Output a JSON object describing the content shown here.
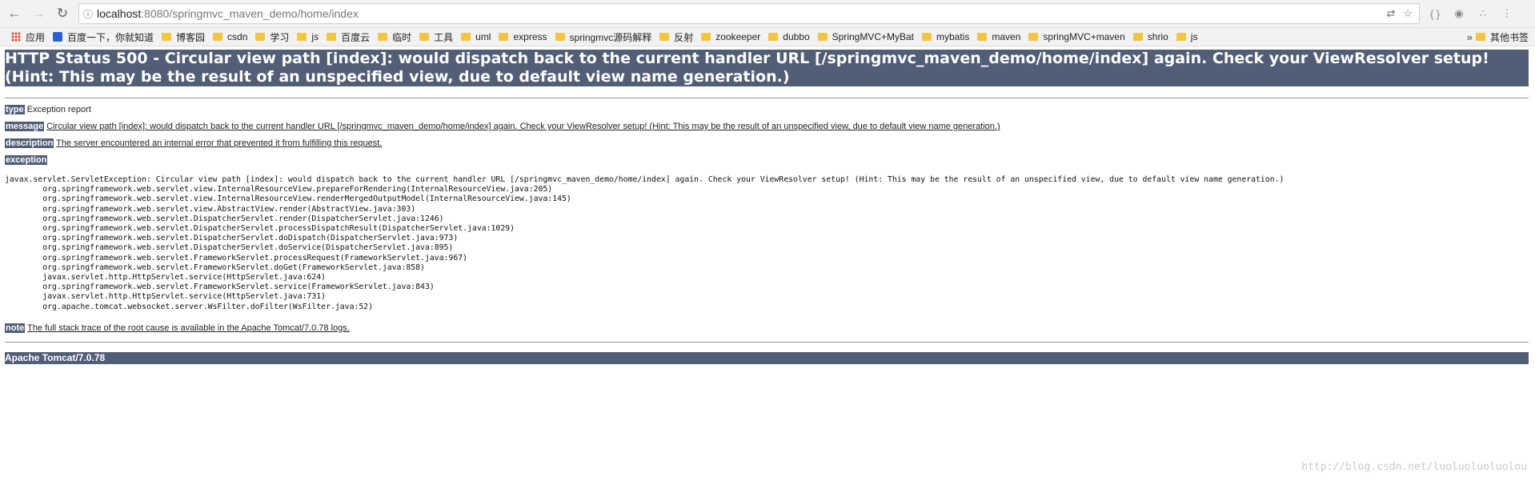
{
  "browser": {
    "url_host": "localhost",
    "url_path": ":8080/springmvc_maven_demo/home/index",
    "bookmarks": [
      "应用",
      "百度一下，你就知道",
      "博客园",
      "csdn",
      "学习",
      "js",
      "百度云",
      "临时",
      "工具",
      "uml",
      "express",
      "springmvc源码解释",
      "反射",
      "zookeeper",
      "dubbo",
      "SpringMVC+MyBat",
      "mybatis",
      "maven",
      "springMVC+maven",
      "shrio",
      "js"
    ],
    "more": "»",
    "other_bookmarks": "其他书签"
  },
  "error": {
    "title": "HTTP Status 500 - Circular view path [index]: would dispatch back to the current handler URL [/springmvc_maven_demo/home/index] again. Check your ViewResolver setup! (Hint: This may be the result of an unspecified view, due to default view name generation.)",
    "type_label": "type",
    "type_value": "Exception report",
    "message_label": "message",
    "message_value": "Circular view path [index]: would dispatch back to the current handler URL [/springmvc_maven_demo/home/index] again. Check your ViewResolver setup! (Hint: This may be the result of an unspecified view, due to default view name generation.)",
    "description_label": "description",
    "description_value": "The server encountered an internal error that prevented it from fulfilling this request.",
    "exception_label": "exception",
    "trace": "javax.servlet.ServletException: Circular view path [index]: would dispatch back to the current handler URL [/springmvc_maven_demo/home/index] again. Check your ViewResolver setup! (Hint: This may be the result of an unspecified view, due to default view name generation.)\n\torg.springframework.web.servlet.view.InternalResourceView.prepareForRendering(InternalResourceView.java:205)\n\torg.springframework.web.servlet.view.InternalResourceView.renderMergedOutputModel(InternalResourceView.java:145)\n\torg.springframework.web.servlet.view.AbstractView.render(AbstractView.java:303)\n\torg.springframework.web.servlet.DispatcherServlet.render(DispatcherServlet.java:1246)\n\torg.springframework.web.servlet.DispatcherServlet.processDispatchResult(DispatcherServlet.java:1029)\n\torg.springframework.web.servlet.DispatcherServlet.doDispatch(DispatcherServlet.java:973)\n\torg.springframework.web.servlet.DispatcherServlet.doService(DispatcherServlet.java:895)\n\torg.springframework.web.servlet.FrameworkServlet.processRequest(FrameworkServlet.java:967)\n\torg.springframework.web.servlet.FrameworkServlet.doGet(FrameworkServlet.java:858)\n\tjavax.servlet.http.HttpServlet.service(HttpServlet.java:624)\n\torg.springframework.web.servlet.FrameworkServlet.service(FrameworkServlet.java:843)\n\tjavax.servlet.http.HttpServlet.service(HttpServlet.java:731)\n\torg.apache.tomcat.websocket.server.WsFilter.doFilter(WsFilter.java:52)",
    "note_label": "note",
    "note_value": "The full stack trace of the root cause is available in the Apache Tomcat/7.0.78 logs.",
    "footer": "Apache Tomcat/7.0.78"
  },
  "watermark": "http://blog.csdn.net/luoluoluoluolou"
}
